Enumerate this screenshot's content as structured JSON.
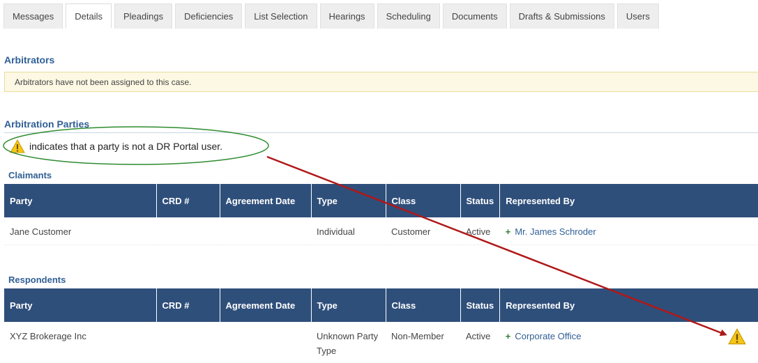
{
  "tabs": [
    {
      "label": "Messages",
      "active": false
    },
    {
      "label": "Details",
      "active": true
    },
    {
      "label": "Pleadings",
      "active": false
    },
    {
      "label": "Deficiencies",
      "active": false
    },
    {
      "label": "List Selection",
      "active": false
    },
    {
      "label": "Hearings",
      "active": false
    },
    {
      "label": "Scheduling",
      "active": false
    },
    {
      "label": "Documents",
      "active": false
    },
    {
      "label": "Drafts & Submissions",
      "active": false
    },
    {
      "label": "Users",
      "active": false
    }
  ],
  "arbitrators": {
    "title": "Arbitrators",
    "notice": "Arbitrators have not been assigned to this case."
  },
  "parties": {
    "title": "Arbitration Parties",
    "legend_text": "indicates that a party is not a DR Portal user.",
    "legend_icon": "warning-icon",
    "columns": [
      "Party",
      "CRD #",
      "Agreement Date",
      "Type",
      "Class",
      "Status",
      "Represented By"
    ],
    "claimants": {
      "title": "Claimants",
      "rows": [
        {
          "party": "Jane Customer",
          "crd": "",
          "agreement_date": "",
          "type": "Individual",
          "class": "Customer",
          "status": "Active",
          "represented_by": "Mr. James Schroder",
          "not_portal_user": false
        }
      ]
    },
    "respondents": {
      "title": "Respondents",
      "rows": [
        {
          "party": "XYZ Brokerage Inc",
          "crd": "",
          "agreement_date": "",
          "type": "Unknown Party Type",
          "class": "Non-Member",
          "status": "Active",
          "represented_by": "Corporate Office",
          "not_portal_user": true
        }
      ]
    }
  },
  "colors": {
    "header_bg": "#2f4f7b",
    "link": "#2f5f95",
    "plus": "#2e7d32",
    "annotation_ellipse": "#2e8b2e",
    "annotation_arrow": "#b01818",
    "warning_fill": "#f5c518"
  }
}
